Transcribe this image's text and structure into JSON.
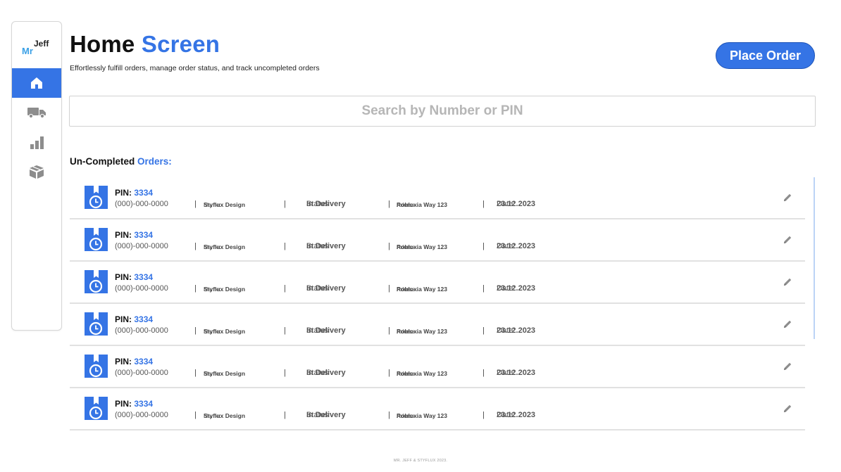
{
  "app": {
    "logo_mr": "Mr",
    "logo_jeff": "Jeff"
  },
  "sidebar": {
    "items": [
      {
        "icon": "home-icon",
        "active": true
      },
      {
        "icon": "truck-icon",
        "active": false
      },
      {
        "icon": "bar-chart-icon",
        "active": false
      },
      {
        "icon": "package-icon",
        "active": false
      }
    ]
  },
  "header": {
    "title_main": "Home",
    "title_accent": "Screen",
    "subtitle": "Effortlessly fulfill orders, manage order status, and track uncompleted orders",
    "place_order_label": "Place Order"
  },
  "search": {
    "placeholder": "Search by Number or PIN",
    "value": ""
  },
  "section": {
    "title_main": "Un-Completed",
    "title_accent": "Orders:"
  },
  "orders": [
    {
      "pin_label": "PIN:",
      "pin": "3334",
      "phone": "(000)-000-0000",
      "name_label": "Name:",
      "name": "Styflux Design",
      "status_label": "Status",
      "status": "In Delivery",
      "address_label": "Adress:",
      "address": "Robloxia Way 123",
      "date_label": "Date:",
      "date": "23.12.2023"
    },
    {
      "pin_label": "PIN:",
      "pin": "3334",
      "phone": "(000)-000-0000",
      "name_label": "Name:",
      "name": "Styflux Design",
      "status_label": "Status",
      "status": "In Delivery",
      "address_label": "Adress:",
      "address": "Robloxia Way 123",
      "date_label": "Date:",
      "date": "23.12.2023"
    },
    {
      "pin_label": "PIN:",
      "pin": "3334",
      "phone": "(000)-000-0000",
      "name_label": "Name:",
      "name": "Styflux Design",
      "status_label": "Status",
      "status": "In Delivery",
      "address_label": "Adress:",
      "address": "Robloxia Way 123",
      "date_label": "Date:",
      "date": "23.12.2023"
    },
    {
      "pin_label": "PIN:",
      "pin": "3334",
      "phone": "(000)-000-0000",
      "name_label": "Name:",
      "name": "Styflux Design",
      "status_label": "Status",
      "status": "In Delivery",
      "address_label": "Adress:",
      "address": "Robloxia Way 123",
      "date_label": "Date:",
      "date": "23.12.2023"
    },
    {
      "pin_label": "PIN:",
      "pin": "3334",
      "phone": "(000)-000-0000",
      "name_label": "Name:",
      "name": "Styflux Design",
      "status_label": "Status",
      "status": "In Delivery",
      "address_label": "Adress:",
      "address": "Robloxia Way 123",
      "date_label": "Date:",
      "date": "23.12.2023"
    },
    {
      "pin_label": "PIN:",
      "pin": "3334",
      "phone": "(000)-000-0000",
      "name_label": "Name:",
      "name": "Styflux Design",
      "status_label": "Status",
      "status": "In Delivery",
      "address_label": "Adress:",
      "address": "Robloxia Way 123",
      "date_label": "Date:",
      "date": "23.12.2023"
    }
  ],
  "footer": {
    "text": "MR. JEFF & STYFLUX 2023."
  },
  "colors": {
    "accent": "#3574e5",
    "icon_gray": "#8d8d8d",
    "divider": "#e1e1e1"
  }
}
